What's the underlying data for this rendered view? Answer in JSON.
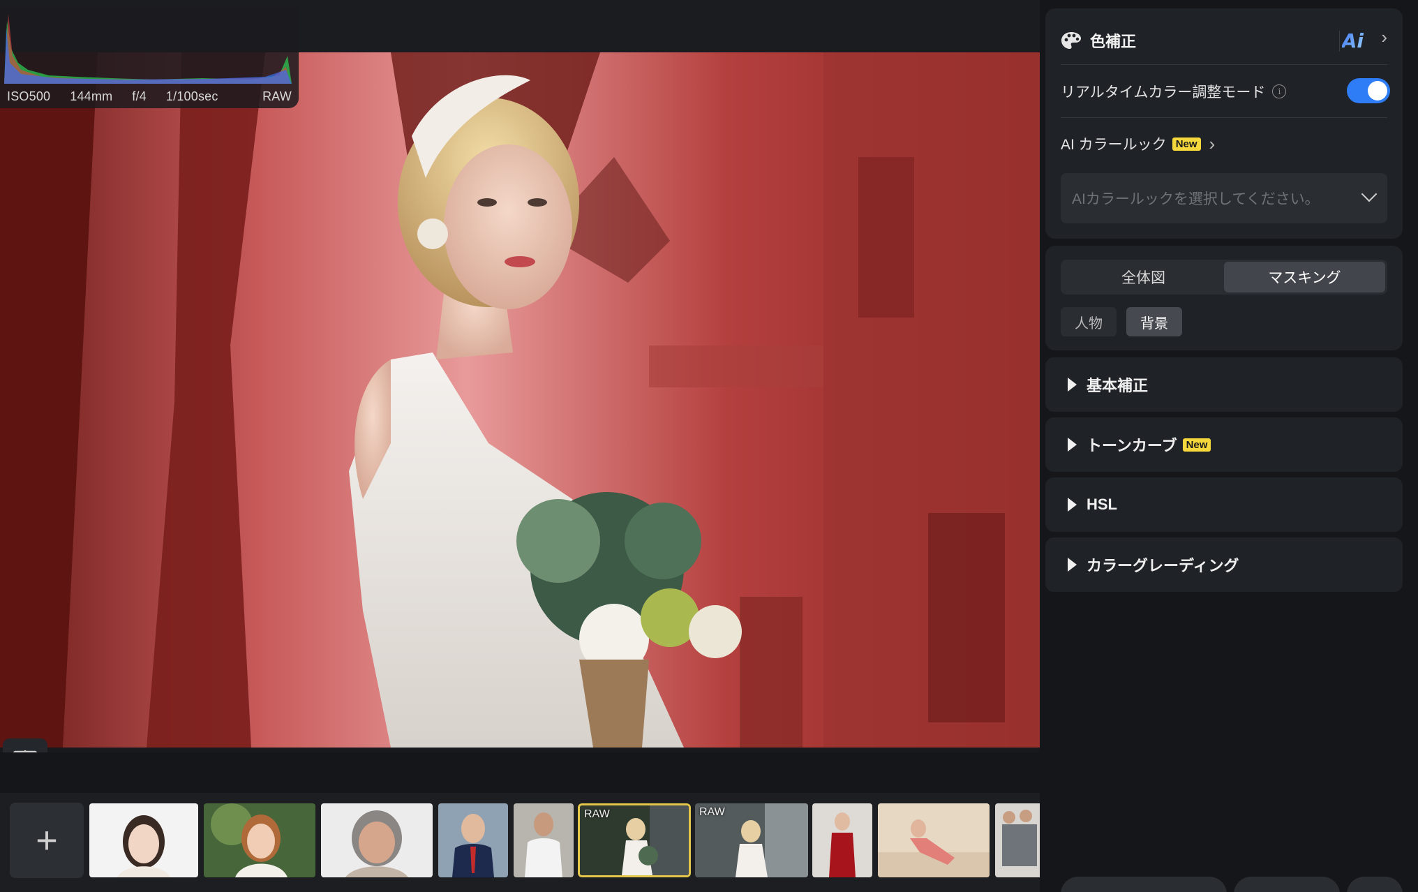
{
  "exif": {
    "iso": "ISO500",
    "focal": "144mm",
    "aperture": "f/4",
    "shutter": "1/100sec",
    "format": "RAW"
  },
  "filmstrip": {
    "add_icon": "+",
    "raw_label": "RAW",
    "thumbs": [
      {
        "name": "woman-white-bg"
      },
      {
        "name": "woman-outdoor-green"
      },
      {
        "name": "elderly-woman"
      },
      {
        "name": "man-suit"
      },
      {
        "name": "man-white-tshirt"
      },
      {
        "name": "bride-selected",
        "raw": true,
        "selected": true
      },
      {
        "name": "bride-building",
        "raw": true
      },
      {
        "name": "woman-red-dress"
      },
      {
        "name": "woman-pink-dress-floor"
      },
      {
        "name": "group-photo"
      }
    ]
  },
  "panel": {
    "color_correction": {
      "title": "色補正",
      "icon": "palette-icon",
      "ai_logo": "Ai",
      "realtime_label": "リアルタイムカラー調整モード",
      "realtime_on": true,
      "ai_look_label": "AI カラールック",
      "new_badge": "New",
      "select_placeholder": "AIカラールックを選択してください。"
    },
    "view": {
      "tabs": [
        "全体図",
        "マスキング"
      ],
      "active_tab": 1,
      "chips": [
        "人物",
        "背景"
      ],
      "active_chip": 1
    },
    "sections": [
      {
        "label": "基本補正",
        "new": false
      },
      {
        "label": "トーンカーブ",
        "new": true
      },
      {
        "label": "HSL",
        "new": false
      },
      {
        "label": "カラーグレーディング",
        "new": false
      }
    ]
  },
  "colors": {
    "accent": "#2f7df6",
    "badge": "#f5d83c",
    "selected_thumb": "#e3c64a",
    "mask_overlay": "#e0504f"
  }
}
